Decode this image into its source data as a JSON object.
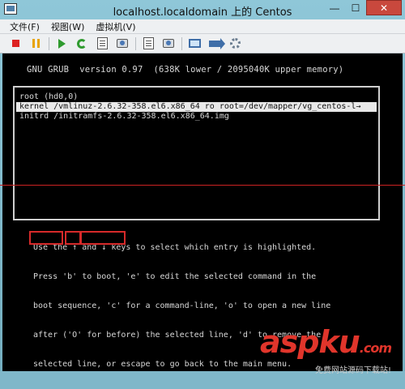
{
  "window": {
    "title": "localhost.localdomain 上的 Centos",
    "controls": {
      "minimize": "—",
      "maximize": "☐",
      "close": "✕"
    }
  },
  "menu": {
    "items": [
      "文件(F)",
      "视图(W)",
      "虚拟机(V)"
    ]
  },
  "toolbar": {
    "icons": [
      "stop-icon",
      "pause-icon",
      "play-icon",
      "reset-icon",
      "document-icon",
      "snapshot-icon",
      "snapshot-manager-icon",
      "console-icon",
      "send-icon",
      "settings-icon"
    ]
  },
  "grub": {
    "header": "GNU GRUB  version 0.97  (638K lower / 2095040K upper memory)",
    "entries": [
      {
        "text": "root (hd0,0)",
        "selected": false
      },
      {
        "text": "kernel /vmlinuz-2.6.32-358.el6.x86_64 ro root=/dev/mapper/vg_centos-l→",
        "selected": true
      },
      {
        "text": "initrd /initramfs-2.6.32-358.el6.x86_64.img",
        "selected": false
      }
    ],
    "help_lines": [
      "Use the ↑ and ↓ keys to select which entry is highlighted.",
      "Press 'b' to boot, 'e' to edit the selected command in the",
      "boot sequence, 'c' for a command-line, 'o' to open a new line",
      "after ('O' for before) the selected line, 'd' to remove the",
      "selected line, or escape to go back to the main menu."
    ]
  },
  "watermark": {
    "logo": "aspku",
    "suffix": ".com",
    "subtitle": "免费网站源码下载站!"
  },
  "colors": {
    "highlight_box": "#d62a2a",
    "title_gradient_top": "#8fc7d8",
    "title_gradient_bottom": "#74aebf",
    "screen_bg": "#000000",
    "watermark_red": "#e0352b"
  }
}
